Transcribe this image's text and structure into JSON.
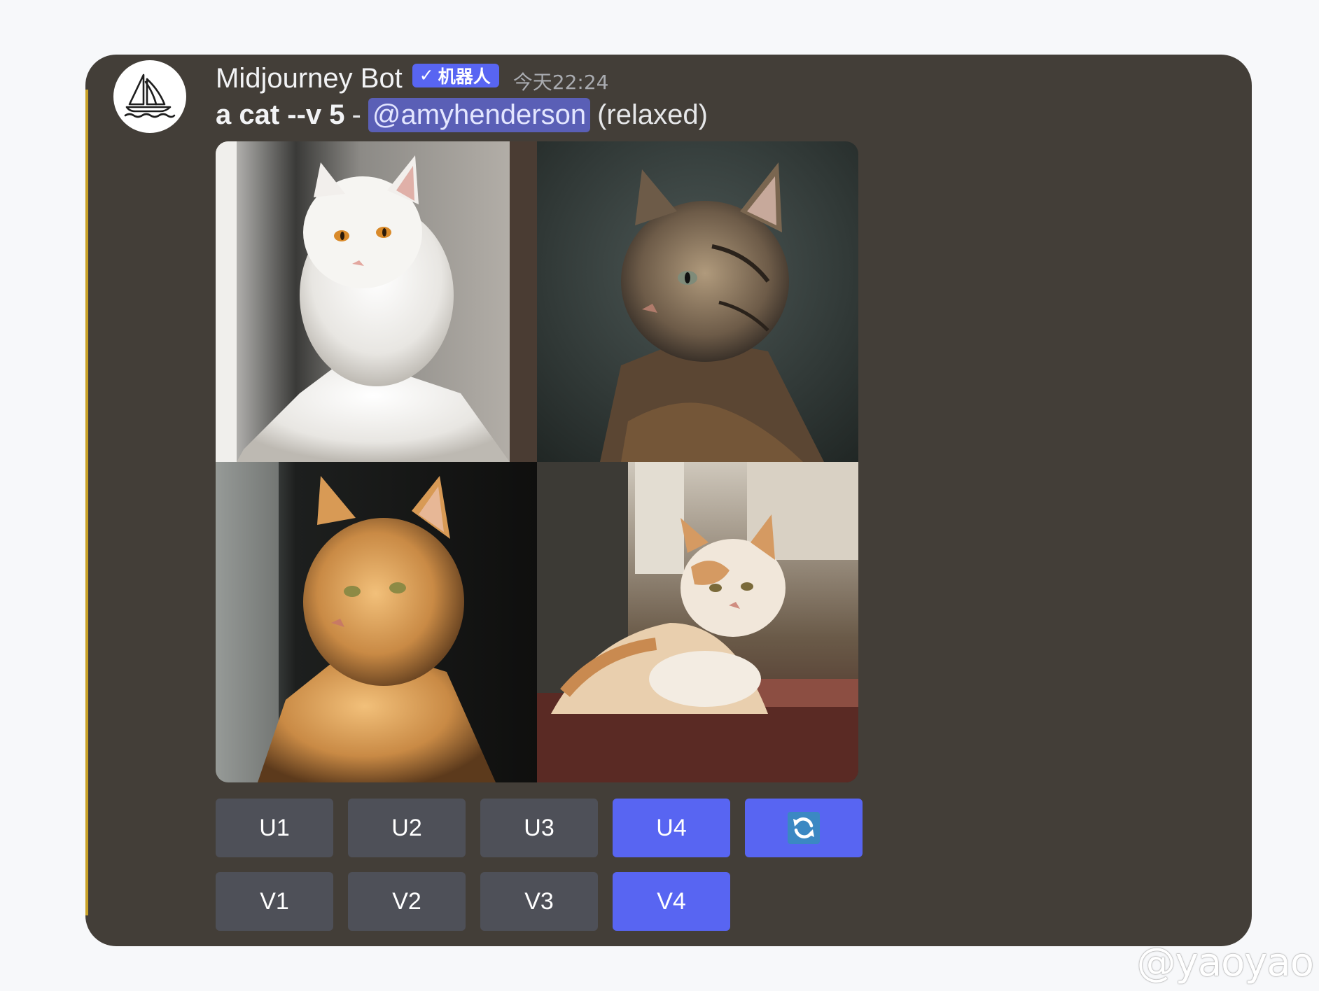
{
  "message": {
    "bot_name": "Midjourney Bot",
    "bot_badge": "机器人",
    "timestamp": "今天22:24",
    "prompt": "a cat --v 5",
    "separator": "-",
    "mention": "@amyhenderson",
    "mode": "(relaxed)"
  },
  "image_grid": {
    "cells": [
      {
        "name": "white-cat-image"
      },
      {
        "name": "tabby-cat-image"
      },
      {
        "name": "orange-cat-image"
      },
      {
        "name": "orange-white-cat-image"
      }
    ]
  },
  "buttons": {
    "upscale": [
      {
        "label": "U1",
        "active": false
      },
      {
        "label": "U2",
        "active": false
      },
      {
        "label": "U3",
        "active": false
      },
      {
        "label": "U4",
        "active": true
      }
    ],
    "reroll_icon": "refresh-icon",
    "variation": [
      {
        "label": "V1",
        "active": false
      },
      {
        "label": "V2",
        "active": false
      },
      {
        "label": "V3",
        "active": false
      },
      {
        "label": "V4",
        "active": true
      }
    ]
  },
  "colors": {
    "card_bg": "#433e38",
    "accent_button": "#5865f2",
    "default_button": "#4e5058",
    "mention_bg": "#5a5fb6",
    "left_accent": "#c9a227"
  },
  "watermark": "@yaoyao"
}
